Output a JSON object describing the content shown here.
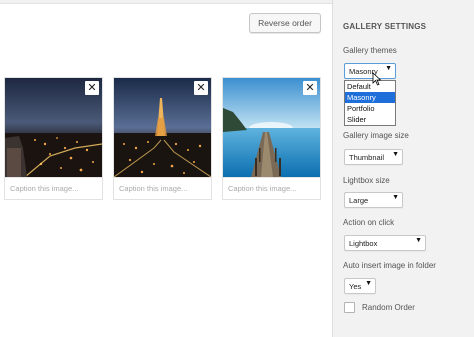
{
  "toolbar": {
    "reverse_label": "Reverse order"
  },
  "gallery": {
    "images": [
      {
        "alt": "Night city view from hillside",
        "caption_placeholder": "Caption this image..."
      },
      {
        "alt": "Eiffel Tower at night",
        "caption_placeholder": "Caption this image..."
      },
      {
        "alt": "Wooden pier over blue sea",
        "caption_placeholder": "Caption this image..."
      }
    ],
    "remove_glyph": "✕"
  },
  "settings": {
    "title": "GALLERY SETTINGS",
    "themes": {
      "label": "Gallery themes",
      "value": "Masonry",
      "options": [
        "Default",
        "Masonry",
        "Portfolio",
        "Slider"
      ],
      "highlighted": "Masonry"
    },
    "image_size": {
      "label": "Gallery image size",
      "value": "Thumbnail"
    },
    "lightbox_size": {
      "label": "Lightbox size",
      "value": "Large"
    },
    "action_on_click": {
      "label": "Action on click",
      "value": "Lightbox"
    },
    "auto_insert": {
      "label": "Auto insert image in folder",
      "value": "Yes"
    },
    "random_order": {
      "label": "Random Order",
      "checked": false
    }
  },
  "icons": {
    "dropdown_arrow": "▼"
  },
  "colors": {
    "sidebar_bg": "#f2f2f2",
    "highlight": "#1e6fd9"
  }
}
